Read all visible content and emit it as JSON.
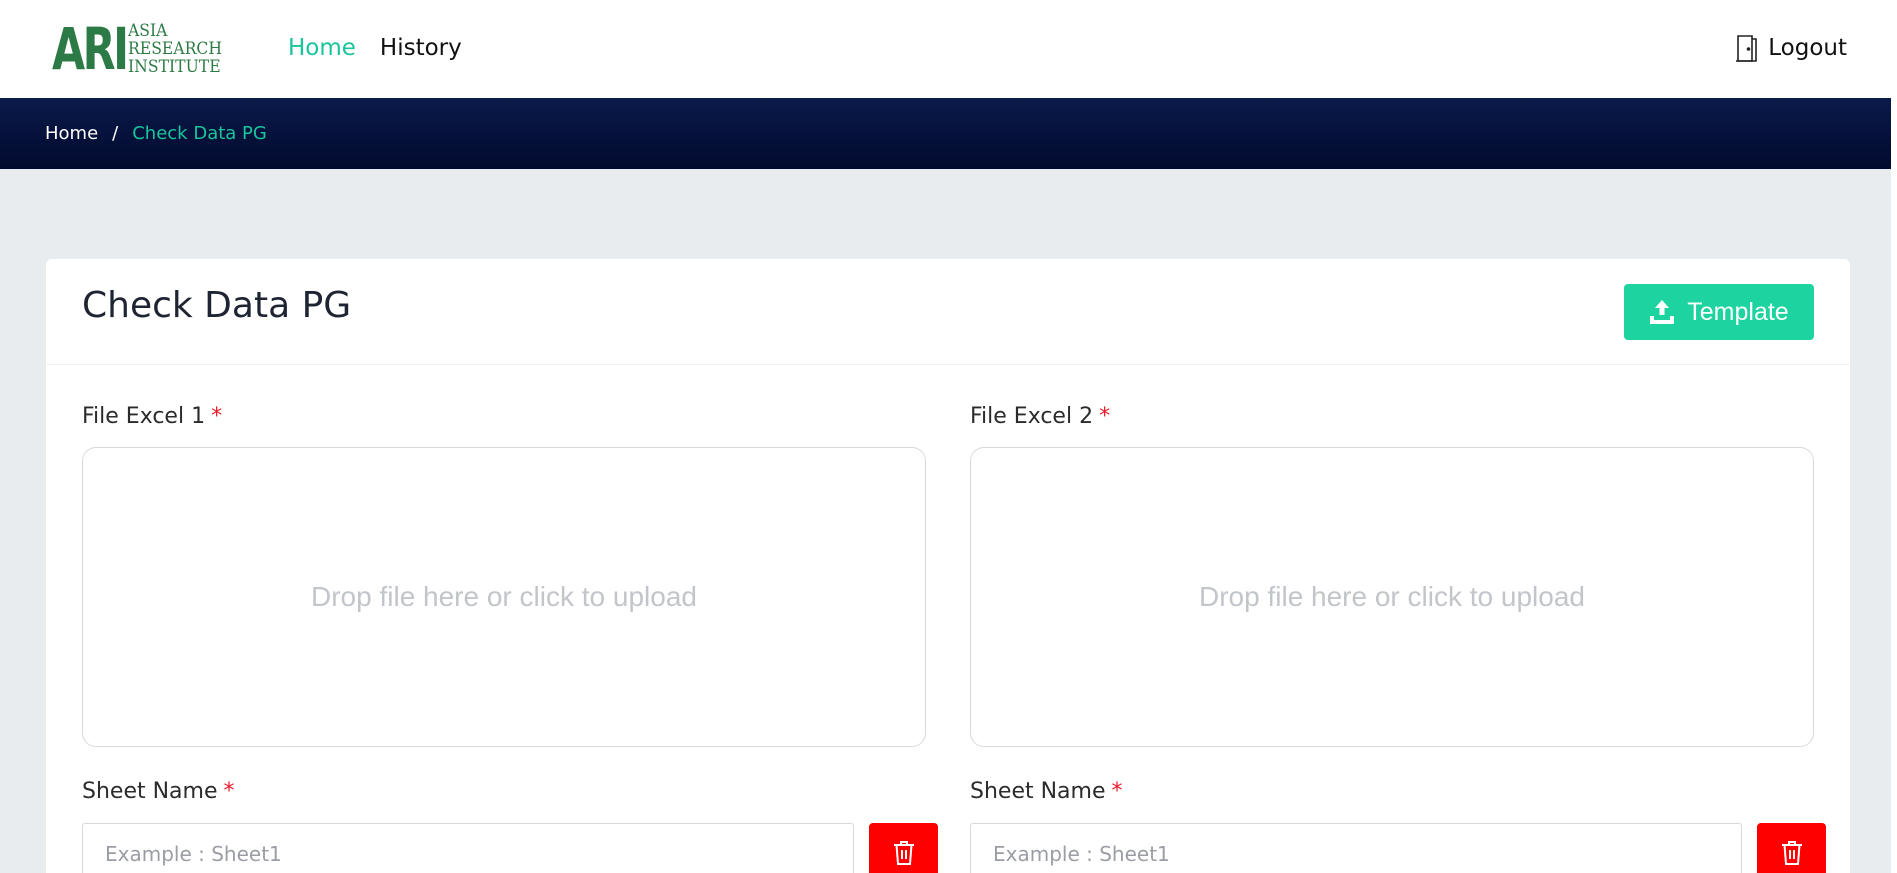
{
  "header": {
    "logo": {
      "mark": "ARI",
      "line1": "ASIA",
      "line2": "RESEARCH",
      "line3": "INSTITUTE",
      "color": "#2c7a45"
    },
    "nav": [
      {
        "label": "Home",
        "active": true
      },
      {
        "label": "History",
        "active": false
      }
    ],
    "logout_label": "Logout",
    "logout_icon": "door-icon"
  },
  "breadcrumb": {
    "home": "Home",
    "separator": "/",
    "current": "Check Data PG"
  },
  "card": {
    "title": "Check Data PG",
    "template_button": {
      "label": "Template",
      "icon": "upload-icon"
    },
    "file1": {
      "label": "File Excel 1",
      "required_mark": "*",
      "dropzone_text": "Drop file here or click to upload"
    },
    "file2": {
      "label": "File Excel 2",
      "required_mark": "*",
      "dropzone_text": "Drop file here or click to upload"
    },
    "sheet1": {
      "label": "Sheet Name",
      "required_mark": "*",
      "placeholder": "Example : Sheet1",
      "delete_icon": "trash-icon"
    },
    "sheet2": {
      "label": "Sheet Name",
      "required_mark": "*",
      "placeholder": "Example : Sheet1",
      "delete_icon": "trash-icon"
    }
  },
  "colors": {
    "accent": "#19c59a",
    "button_green": "#1dd39f",
    "danger": "#ff0000",
    "navy": "#020a2e",
    "page_bg": "#e8ecef"
  }
}
